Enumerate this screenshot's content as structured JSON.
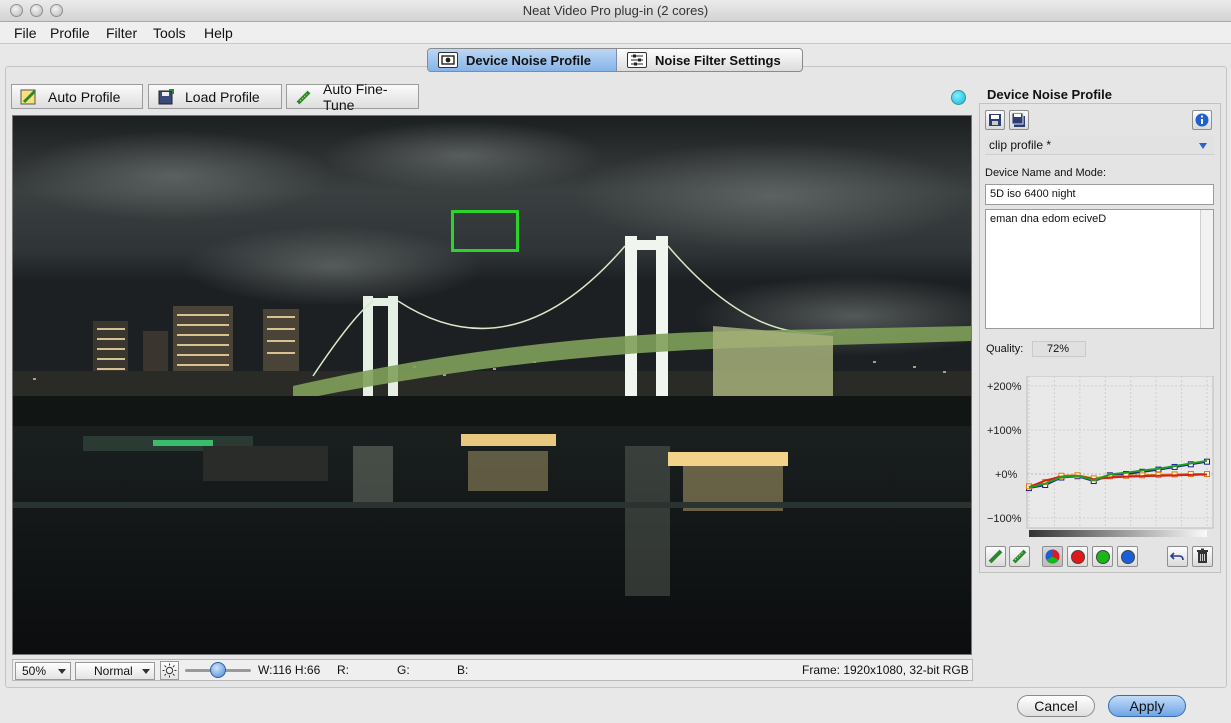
{
  "window": {
    "title": "Neat Video Pro plug-in (2 cores)"
  },
  "menu": {
    "items": [
      "File",
      "Profile",
      "Filter",
      "Tools",
      "Help"
    ]
  },
  "tabs": [
    {
      "label": "Device Noise Profile",
      "active": true
    },
    {
      "label": "Noise Filter Settings",
      "active": false
    }
  ],
  "toolbar": {
    "auto_profile": "Auto Profile",
    "load_profile": "Load Profile",
    "auto_fine_tune": "Auto Fine-Tune",
    "status_color": "#1fc8e6"
  },
  "preview": {
    "description_icon": "night-city-bridge-photo"
  },
  "bottom_bar": {
    "zoom": "50%",
    "mode": "Normal",
    "brightness_slider_value": 0.5,
    "size": "W:116 H:66",
    "r_label": "R:",
    "g_label": "G:",
    "b_label": "B:",
    "frame_info": "Frame: 1920x1080, 32-bit RGB"
  },
  "sidebar": {
    "title": "Device Noise Profile",
    "profile_select": "clip profile *",
    "device_name_label": "Device Name and Mode:",
    "device_name_value": "5D iso 6400 night",
    "description_value": "eman dna edom eciveD",
    "quality_label": "Quality:",
    "quality_value": "72%",
    "graph": {
      "y_labels": [
        "+200%",
        "+100%",
        "+0%",
        "−100%"
      ],
      "series": [
        {
          "color": "#1a1a9a",
          "values": [
            -32,
            -25,
            -8,
            -5,
            -16,
            -3,
            0,
            5,
            10,
            16,
            22,
            28
          ]
        },
        {
          "color": "#e07a10",
          "values": [
            -28,
            -18,
            -4,
            -3,
            -10,
            -5,
            -4,
            -3,
            -2,
            -1,
            0,
            0
          ]
        },
        {
          "color": "#d02020",
          "values": [
            -30,
            -15,
            -6,
            -4,
            -12,
            -8,
            -6,
            -5,
            -4,
            -3,
            -2,
            -1
          ]
        },
        {
          "color": "#20a020",
          "values": [
            -31,
            -22,
            -7,
            -4,
            -14,
            -1,
            3,
            8,
            12,
            18,
            24,
            30
          ]
        }
      ],
      "series_colors": {
        "all": "mixed",
        "red": "#e01818",
        "green": "#18b818",
        "blue": "#1a5fd8"
      }
    }
  },
  "footer": {
    "cancel": "Cancel",
    "apply": "Apply"
  }
}
